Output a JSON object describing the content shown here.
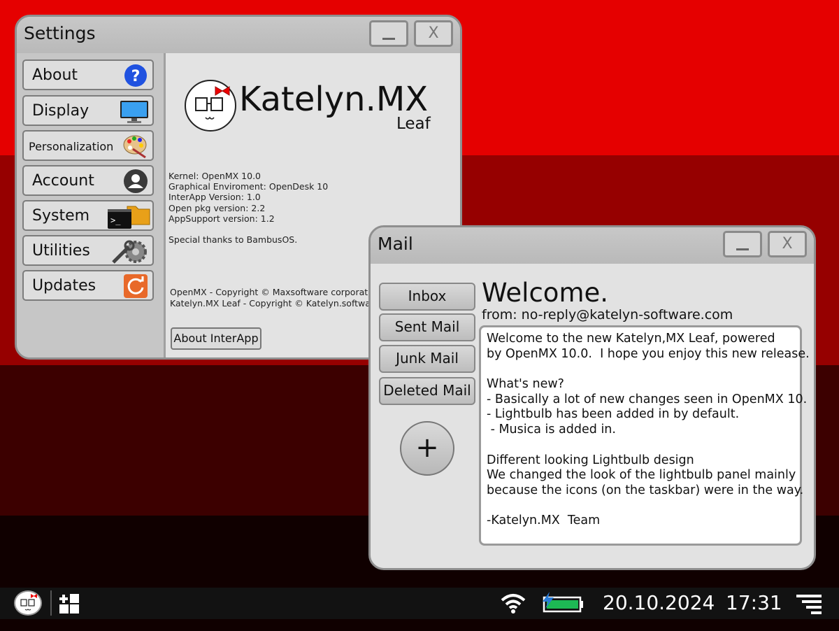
{
  "colors": {
    "desktop_band_1": "#e50000",
    "desktop_band_2": "#960000",
    "desktop_band_3": "#3c0000",
    "desktop_band_4": "#100000",
    "battery": "#1db954",
    "updates_icon": "#e8692a",
    "about_icon": "#2052e0"
  },
  "settings": {
    "title": "Settings",
    "minimize_label": "",
    "close_label": "X",
    "sidebar": [
      {
        "label": "About",
        "icon": "help-icon"
      },
      {
        "label": "Display",
        "icon": "monitor-icon"
      },
      {
        "label": "Personalization",
        "icon": "palette-icon"
      },
      {
        "label": "Account",
        "icon": "user-icon"
      },
      {
        "label": "System",
        "icon": "terminal-folder-icon"
      },
      {
        "label": "Utilities",
        "icon": "wrench-gear-icon"
      },
      {
        "label": "Updates",
        "icon": "refresh-icon"
      }
    ],
    "brand": "Katelyn.MX",
    "edition": "Leaf",
    "info": [
      "Kernel: OpenMX 10.0",
      "Graphical Enviroment: OpenDesk 10",
      "InterApp Version: 1.0",
      "Open pkg version: 2.2",
      "AppSupport version: 1.2"
    ],
    "thanks": "Special thanks to BambusOS.",
    "copyright": [
      "OpenMX - Copyright © Maxsoftware corporation",
      "Katelyn.MX Leaf - Copyright © Katelyn.software"
    ],
    "about_button": "About InterApp"
  },
  "mail": {
    "title": "Mail",
    "minimize_label": "",
    "close_label": "X",
    "folders": [
      "Inbox",
      "Sent Mail",
      "Junk Mail",
      "Deleted Mail"
    ],
    "compose_label": "+",
    "message_title": "Welcome.",
    "from": "from: no-reply@katelyn-software.com",
    "body": [
      "Welcome to the new Katelyn,MX Leaf, powered",
      "by OpenMX 10.0.  I hope you enjoy this new release.",
      "",
      "What's new?",
      "- Basically a lot of new changes seen in OpenMX 10.",
      "- Lightbulb has been added in by default.",
      " - Musica is added in.",
      "",
      "Different looking Lightbulb design",
      "We changed the look of the lightbulb panel mainly",
      "because the icons (on the taskbar) were in the way.",
      "",
      "-Katelyn.MX  Team"
    ]
  },
  "taskbar": {
    "date": "20.10.2024",
    "time": "17:31",
    "icons": [
      "logo-icon",
      "apps-grid-icon",
      "wifi-icon",
      "battery-icon",
      "menu-icon"
    ]
  }
}
